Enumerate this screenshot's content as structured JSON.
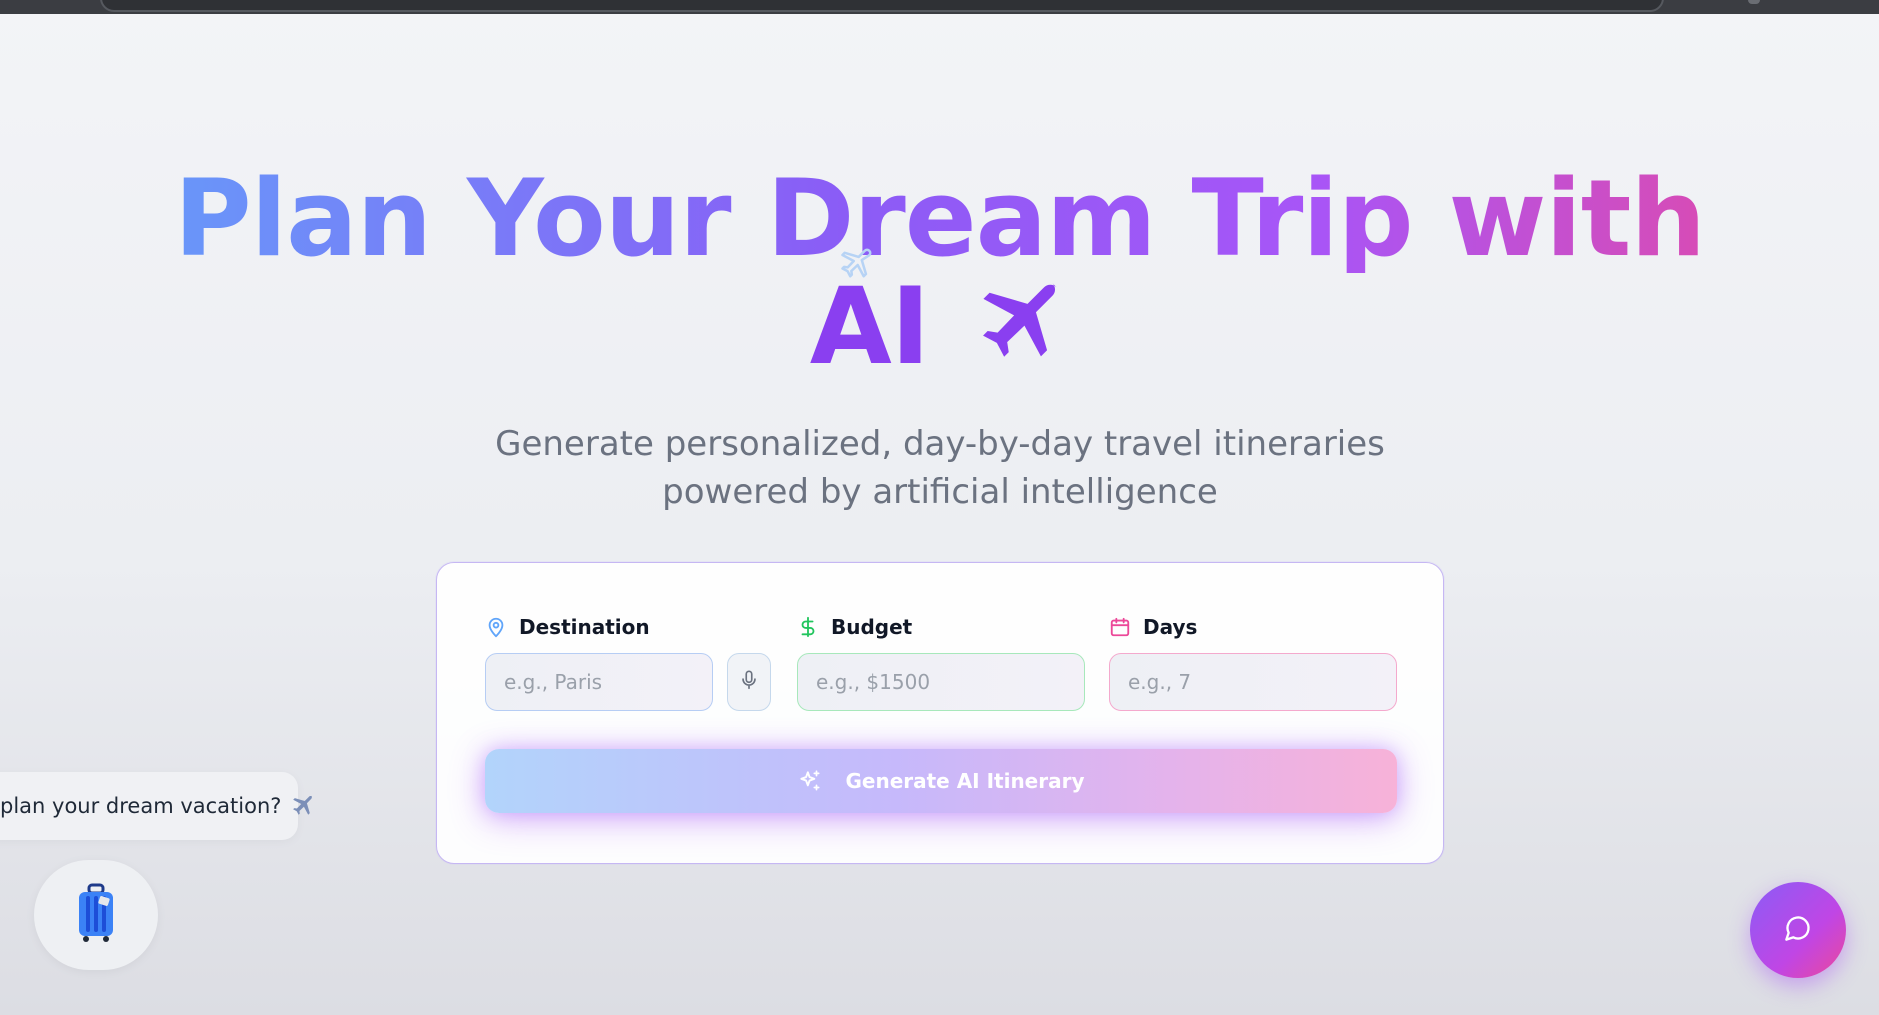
{
  "hero": {
    "title_line1": "Plan Your Dream Trip with",
    "title_line2": "AI",
    "subtitle": "Generate personalized, day-by-day travel itineraries powered by artificial intelligence"
  },
  "form": {
    "destination": {
      "label": "Destination",
      "placeholder": "e.g., Paris"
    },
    "budget": {
      "label": "Budget",
      "placeholder": "e.g., $1500"
    },
    "days": {
      "label": "Days",
      "placeholder": "e.g., 7"
    },
    "submit_label": "Generate AI Itinerary"
  },
  "chat_bubble": {
    "text": "plan your dream vacation?"
  },
  "icons": {
    "title_plane": "airplane-icon",
    "destination": "map-pin-icon",
    "budget": "dollar-icon",
    "days": "calendar-icon",
    "mic": "microphone-icon",
    "submit": "sparkles-icon",
    "bubble": "airplane-icon",
    "luggage": "luggage-icon",
    "chat": "message-circle-icon"
  },
  "colors": {
    "accent_purple": "#8b5cf6",
    "accent_pink": "#ec4899",
    "accent_blue": "#60a5fa",
    "budget_green": "#22c55e",
    "days_pink": "#ec4899"
  }
}
